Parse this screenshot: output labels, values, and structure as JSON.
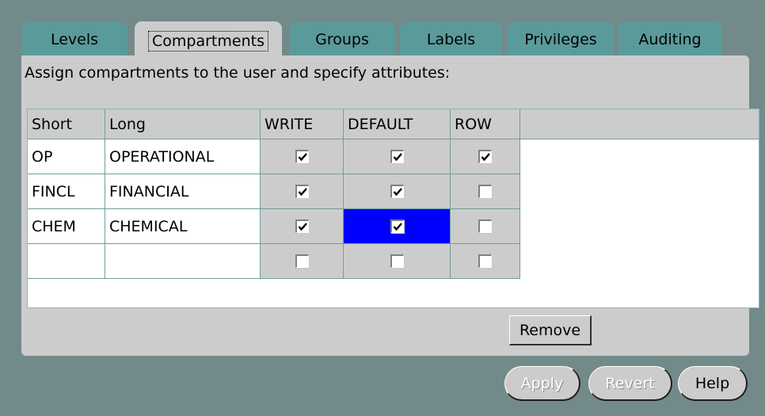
{
  "tabs": [
    "Levels",
    "Compartments",
    "Groups",
    "Labels",
    "Privileges",
    "Auditing"
  ],
  "active_tab": "Compartments",
  "instruction": "Assign compartments to the user and specify attributes:",
  "table": {
    "columns": [
      "Short",
      "Long",
      "WRITE",
      "DEFAULT",
      "ROW"
    ],
    "rows": [
      {
        "short": "OP",
        "long": "OPERATIONAL",
        "write": true,
        "default": true,
        "row": true
      },
      {
        "short": "FINCL",
        "long": "FINANCIAL",
        "write": true,
        "default": true,
        "row": false
      },
      {
        "short": "CHEM",
        "long": "CHEMICAL",
        "write": true,
        "default": true,
        "row": false
      },
      {
        "short": "",
        "long": "",
        "write": false,
        "default": false,
        "row": false
      }
    ],
    "selected_cell": {
      "row": 2,
      "column": "default"
    }
  },
  "buttons": {
    "remove": "Remove",
    "apply": "Apply",
    "revert": "Revert",
    "help": "Help"
  },
  "colors": {
    "background": "#738a8a",
    "tab": "#5b9a9a",
    "panel": "#cccccc",
    "selection": "#0000ff"
  }
}
